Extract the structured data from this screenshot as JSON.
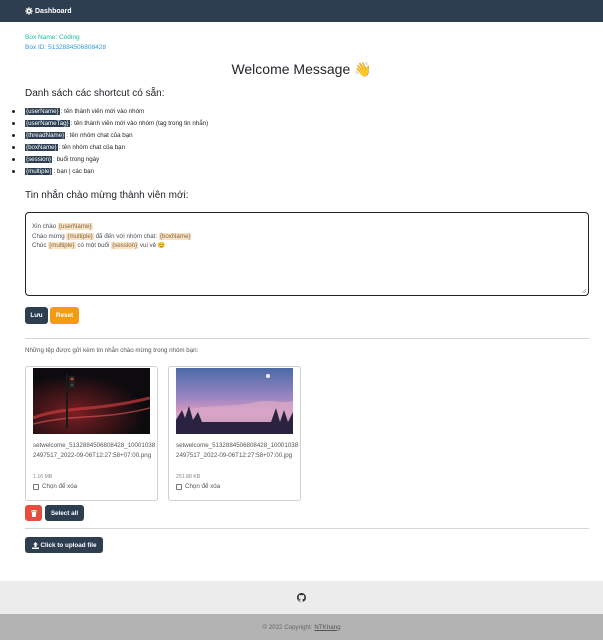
{
  "navbar": {
    "brand_label": "Dashboard",
    "brand_icon": "gear-icon"
  },
  "box": {
    "name_line": "Box Name: Coding",
    "id_line": "Box ID: 5132884506808428"
  },
  "page": {
    "title": "Welcome Message 👋"
  },
  "shortcuts": {
    "heading": "Danh sách các shortcut có sẵn:",
    "items": [
      {
        "tag": "{userName}",
        "desc": ": tên thành viên mới vào nhóm"
      },
      {
        "tag": "{userNameTag}",
        "desc": ": tên thành viên mới vào nhóm (tag trong tin nhắn)"
      },
      {
        "tag": "{threadName}",
        "desc": ": tên nhóm chat của bạn"
      },
      {
        "tag": "{boxName}",
        "desc": ": tên nhóm chat của bạn"
      },
      {
        "tag": "{session}",
        "desc": ": buổi trong ngày"
      },
      {
        "tag": "{multiple}",
        "desc": ": bạn | các bạn"
      }
    ]
  },
  "welcome": {
    "heading": "Tin nhắn chào mừng thành viên mới:",
    "lines": [
      {
        "t1": "Xin chào ",
        "h1": "{userName}",
        "t2": "",
        "h2": "",
        "t3": ""
      },
      {
        "t1": "Chào mừng ",
        "h1": "{multiple}",
        "t2": " đã đến với nhóm chat: ",
        "h2": "{boxName}",
        "t3": ""
      },
      {
        "t1": "Chúc ",
        "h1": "{multiple}",
        "t2": " có một buổi ",
        "h2": "{session}",
        "t3": " vui vẻ 😊"
      }
    ]
  },
  "actions": {
    "save_label": "Lưu",
    "reset_label": "Reset"
  },
  "files": {
    "label": "Những tệp được gửi kèm tin nhắn chào mừng trong nhóm bạn:",
    "items": [
      {
        "name": "setwelcome_5132884506808428_100010382497517_2022-09-06T12:27:58+07:00.png",
        "size": "1.16 MB",
        "checkbox_label": "Chọn để xóa"
      },
      {
        "name": "setwelcome_5132884506808428_100010382497517_2022-09-06T12:27:58+07:00.jpg",
        "size": "251.88 KB",
        "checkbox_label": "Chọn để xóa"
      }
    ]
  },
  "bulk": {
    "select_all_label": "Select all",
    "delete_icon": "trash-icon"
  },
  "upload": {
    "label": "Click to upload file",
    "icon": "upload-icon"
  },
  "footer": {
    "icon": "github-icon",
    "copyright": "© 2022 Copyright:",
    "author": "NTKhang"
  },
  "colors": {
    "navbar": "#2c3e50",
    "primary": "#2c3e50",
    "warning": "#f39c12",
    "danger": "#e74c3c",
    "box_name": "#18bc9c",
    "box_id": "#3498db",
    "highlight": "#fde3c2"
  }
}
